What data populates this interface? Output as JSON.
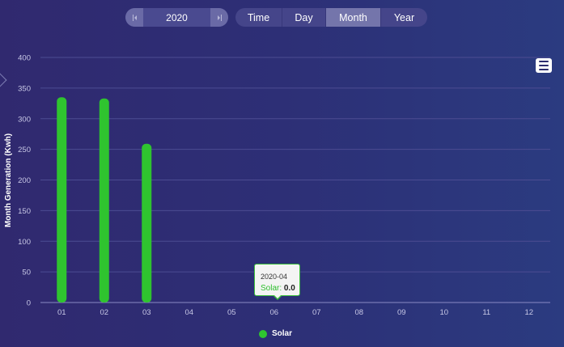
{
  "controls": {
    "year": "2020",
    "prev_icon": "skip-back-icon",
    "next_icon": "skip-forward-icon",
    "tabs": [
      {
        "label": "Time",
        "active": false
      },
      {
        "label": "Day",
        "active": false
      },
      {
        "label": "Month",
        "active": true
      },
      {
        "label": "Year",
        "active": false
      }
    ],
    "menu_icon": "hamburger-menu-icon"
  },
  "colors": {
    "background": "#30296f",
    "series": "#2fc42f",
    "grid": "#4c4c92",
    "axis_text": "#c8c8e6"
  },
  "tooltip": {
    "title": "2020-04",
    "series": "Solar",
    "value": "0.0"
  },
  "chart_data": {
    "type": "bar",
    "title": "",
    "xlabel": "",
    "ylabel": "Month Generation (Kwh)",
    "ylim": [
      0,
      400
    ],
    "yticks": [
      0,
      50,
      100,
      150,
      200,
      250,
      300,
      350,
      400
    ],
    "categories": [
      "01",
      "02",
      "03",
      "04",
      "05",
      "06",
      "07",
      "08",
      "09",
      "10",
      "11",
      "12"
    ],
    "series": [
      {
        "name": "Solar",
        "color": "#2fc42f",
        "values": [
          335,
          333,
          259,
          0,
          0,
          0,
          0,
          0,
          0,
          0,
          0,
          0
        ]
      }
    ],
    "grid": true,
    "legend_position": "bottom-center"
  }
}
